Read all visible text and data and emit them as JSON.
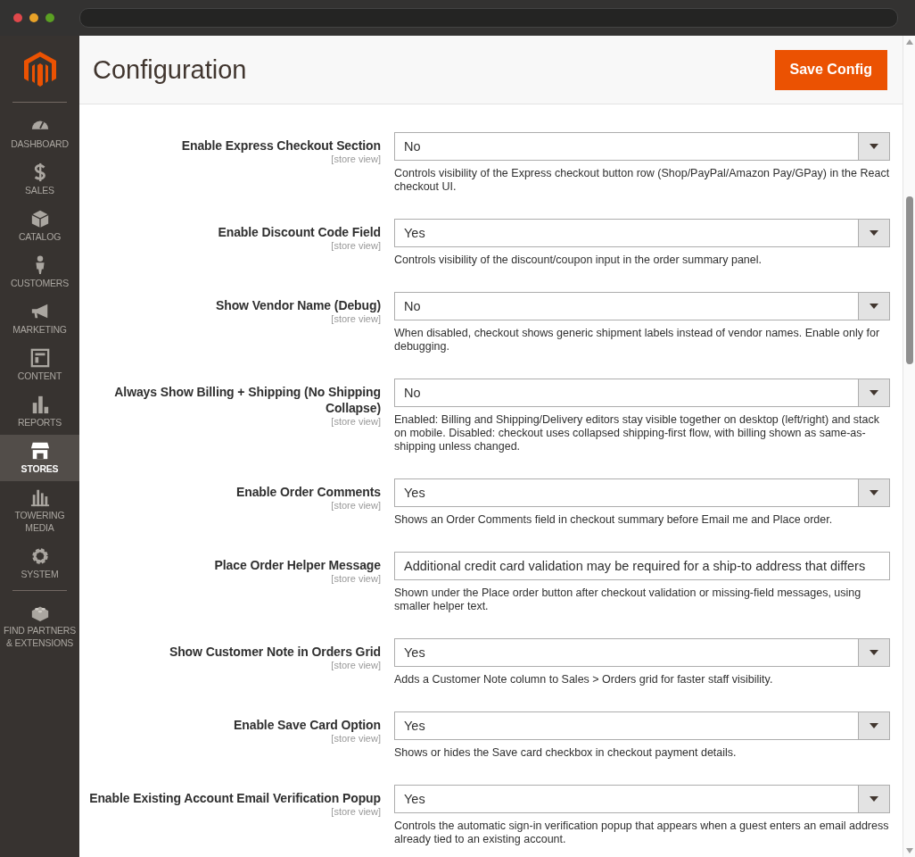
{
  "nav": [
    {
      "label": "DASHBOARD",
      "selected": false
    },
    {
      "label": "SALES",
      "selected": false
    },
    {
      "label": "CATALOG",
      "selected": false
    },
    {
      "label": "CUSTOMERS",
      "selected": false
    },
    {
      "label": "MARKETING",
      "selected": false
    },
    {
      "label": "CONTENT",
      "selected": false
    },
    {
      "label": "REPORTS",
      "selected": false
    },
    {
      "label": "STORES",
      "selected": true
    },
    {
      "label": "TOWERING MEDIA",
      "selected": false
    },
    {
      "label": "SYSTEM",
      "selected": false
    },
    {
      "label": "FIND PARTNERS & EXTENSIONS",
      "selected": false
    }
  ],
  "header": {
    "title": "Configuration",
    "save_button": "Save Config"
  },
  "rows": [
    {
      "label": "Enable Express Checkout Section",
      "scope": "[store view]",
      "kind": "select",
      "value": "No",
      "note": "Controls visibility of the Express checkout button row (Shop/PayPal/Amazon Pay/GPay) in the React checkout UI."
    },
    {
      "label": "Enable Discount Code Field",
      "scope": "[store view]",
      "kind": "select",
      "value": "Yes",
      "note": "Controls visibility of the discount/coupon input in the order summary panel."
    },
    {
      "label": "Show Vendor Name (Debug)",
      "scope": "[store view]",
      "kind": "select",
      "value": "No",
      "note": "When disabled, checkout shows generic shipment labels instead of vendor names. Enable only for debugging."
    },
    {
      "label": "Always Show Billing + Shipping (No Shipping Collapse)",
      "scope": "[store view]",
      "kind": "select",
      "value": "No",
      "note": "Enabled: Billing and Shipping/Delivery editors stay visible together on desktop (left/right) and stack on mobile. Disabled: checkout uses collapsed shipping-first flow, with billing shown as same-as-shipping unless changed."
    },
    {
      "label": "Enable Order Comments",
      "scope": "[store view]",
      "kind": "select",
      "value": "Yes",
      "note": "Shows an Order Comments field in checkout summary before Email me and Place order."
    },
    {
      "label": "Place Order Helper Message",
      "scope": "[store view]",
      "kind": "text",
      "value": "Additional credit card validation may be required for a ship-to address that differs",
      "note": "Shown under the Place order button after checkout validation or missing-field messages, using smaller helper text."
    },
    {
      "label": "Show Customer Note in Orders Grid",
      "scope": "[store view]",
      "kind": "select",
      "value": "Yes",
      "note": "Adds a Customer Note column to Sales > Orders grid for faster staff visibility."
    },
    {
      "label": "Enable Save Card Option",
      "scope": "[store view]",
      "kind": "select",
      "value": "Yes",
      "note": "Shows or hides the Save card checkbox in checkout payment details."
    },
    {
      "label": "Enable Existing Account Email Verification Popup",
      "scope": "[store view]",
      "kind": "select",
      "value": "Yes",
      "note": "Controls the automatic sign-in verification popup that appears when a guest enters an email address already tied to an existing account."
    }
  ]
}
